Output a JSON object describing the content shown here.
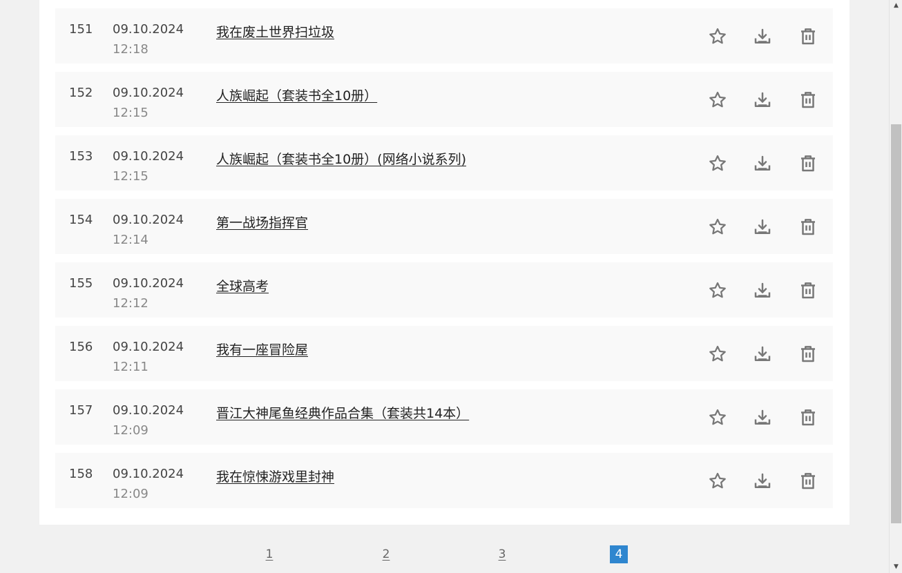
{
  "rows": [
    {
      "num": "151",
      "date": "09.10.2024",
      "time": "12:18",
      "title": "我在废土世界扫垃圾"
    },
    {
      "num": "152",
      "date": "09.10.2024",
      "time": "12:15",
      "title": "人族崛起（套装书全10册）"
    },
    {
      "num": "153",
      "date": "09.10.2024",
      "time": "12:15",
      "title": "人族崛起（套装书全10册）(网络小说系列)"
    },
    {
      "num": "154",
      "date": "09.10.2024",
      "time": "12:14",
      "title": "第一战场指挥官"
    },
    {
      "num": "155",
      "date": "09.10.2024",
      "time": "12:12",
      "title": "全球高考"
    },
    {
      "num": "156",
      "date": "09.10.2024",
      "time": "12:11",
      "title": "我有一座冒险屋"
    },
    {
      "num": "157",
      "date": "09.10.2024",
      "time": "12:09",
      "title": "晋江大神尾鱼经典作品合集（套装共14本）"
    },
    {
      "num": "158",
      "date": "09.10.2024",
      "time": "12:09",
      "title": "我在惊悚游戏里封神"
    }
  ],
  "actions": {
    "favorite_icon": "star-outline-icon",
    "download_icon": "download-icon",
    "delete_icon": "trash-icon"
  },
  "pagination": {
    "pages": [
      "1",
      "2",
      "3",
      "4"
    ],
    "current": "4"
  },
  "colors": {
    "accent": "#2f86cf",
    "row_bg": "#f9f9f9",
    "icon": "#777777"
  }
}
